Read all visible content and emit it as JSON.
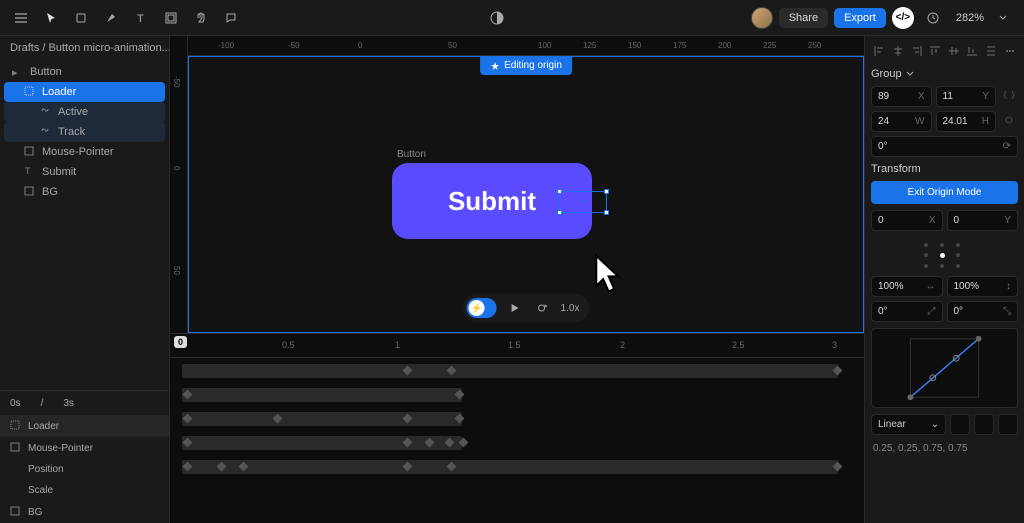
{
  "topbar": {
    "zoom": "282%",
    "share": "Share",
    "export": "Export"
  },
  "breadcrumb": "Drafts / Button micro-animation...",
  "tree": {
    "items": [
      {
        "label": "Button"
      },
      {
        "label": "Loader"
      },
      {
        "label": "Active"
      },
      {
        "label": "Track"
      },
      {
        "label": "Mouse-Pointer"
      },
      {
        "label": "Submit"
      },
      {
        "label": "BG"
      }
    ]
  },
  "canvas": {
    "editing_badge": "Editing origin",
    "element_label": "Button",
    "submit_text": "Submit",
    "speed": "1.0x",
    "hruler": [
      "-100",
      "-50",
      "0",
      "50",
      "100",
      "125",
      "150",
      "175",
      "200",
      "225",
      "250"
    ],
    "vruler": [
      "-50",
      "0",
      "50"
    ]
  },
  "timeline": {
    "start": "0s",
    "end": "3s",
    "playhead": "0",
    "ticks": [
      "0.5",
      "1",
      "1.5",
      "2",
      "2.5",
      "3"
    ],
    "tracks": [
      {
        "label": "Loader"
      },
      {
        "label": "Mouse-Pointer"
      },
      {
        "label": "Position"
      },
      {
        "label": "Scale"
      },
      {
        "label": "BG"
      }
    ]
  },
  "props": {
    "group_label": "Group",
    "x": "89",
    "xl": "X",
    "y": "11",
    "yl": "Y",
    "w": "24",
    "wl": "W",
    "h": "24.01",
    "hl": "H",
    "rot": "0°",
    "transform_label": "Transform",
    "exit_btn": "Exit Origin Mode",
    "tx": "0",
    "txl": "X",
    "ty": "0",
    "tyl": "Y",
    "sx": "100%",
    "sy": "100%",
    "rx": "0°",
    "ry": "0°",
    "ease_label": "Linear",
    "bezier": "0.25, 0.25, 0.75, 0.75"
  }
}
